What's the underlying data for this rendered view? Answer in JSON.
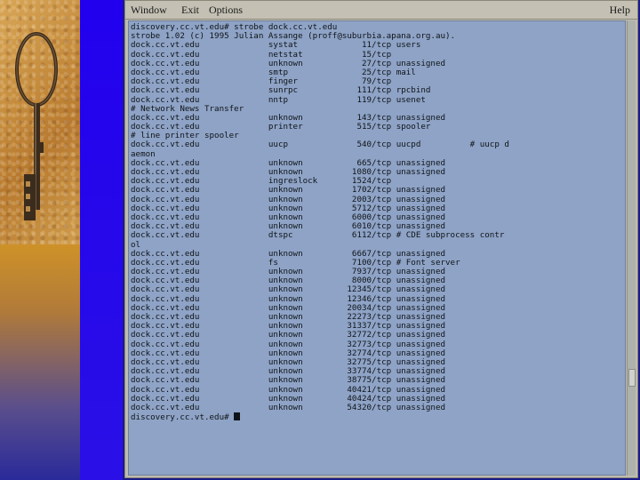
{
  "menubar": {
    "window_label": "Window",
    "exit_label": "Exit",
    "options_label": "Options",
    "help_label": "Help"
  },
  "terminal": {
    "lines": [
      "discovery.cc.vt.edu# strobe dock.cc.vt.edu",
      "strobe 1.02 (c) 1995 Julian Assange (proff@suburbia.apana.org.au).",
      "dock.cc.vt.edu              systat             11/tcp users",
      "dock.cc.vt.edu              netstat            15/tcp",
      "dock.cc.vt.edu              unknown            27/tcp unassigned",
      "dock.cc.vt.edu              smtp               25/tcp mail",
      "dock.cc.vt.edu              finger             79/tcp",
      "dock.cc.vt.edu              sunrpc            111/tcp rpcbind",
      "dock.cc.vt.edu              nntp              119/tcp usenet",
      "# Network News Transfer",
      "dock.cc.vt.edu              unknown           143/tcp unassigned",
      "dock.cc.vt.edu              printer           515/tcp spooler",
      "# line printer spooler",
      "dock.cc.vt.edu              uucp              540/tcp uucpd          # uucp d",
      "aemon",
      "dock.cc.vt.edu              unknown           665/tcp unassigned",
      "dock.cc.vt.edu              unknown          1080/tcp unassigned",
      "dock.cc.vt.edu              ingreslock       1524/tcp",
      "dock.cc.vt.edu              unknown          1702/tcp unassigned",
      "dock.cc.vt.edu              unknown          2003/tcp unassigned",
      "dock.cc.vt.edu              unknown          5712/tcp unassigned",
      "dock.cc.vt.edu              unknown          6000/tcp unassigned",
      "dock.cc.vt.edu              unknown          6010/tcp unassigned",
      "dock.cc.vt.edu              dtspc            6112/tcp # CDE subprocess contr",
      "ol",
      "dock.cc.vt.edu              unknown          6667/tcp unassigned",
      "dock.cc.vt.edu              fs               7100/tcp # Font server",
      "dock.cc.vt.edu              unknown          7937/tcp unassigned",
      "dock.cc.vt.edu              unknown          8000/tcp unassigned",
      "dock.cc.vt.edu              unknown         12345/tcp unassigned",
      "dock.cc.vt.edu              unknown         12346/tcp unassigned",
      "dock.cc.vt.edu              unknown         20034/tcp unassigned",
      "dock.cc.vt.edu              unknown         22273/tcp unassigned",
      "dock.cc.vt.edu              unknown         31337/tcp unassigned",
      "dock.cc.vt.edu              unknown         32772/tcp unassigned",
      "dock.cc.vt.edu              unknown         32773/tcp unassigned",
      "dock.cc.vt.edu              unknown         32774/tcp unassigned",
      "dock.cc.vt.edu              unknown         32775/tcp unassigned",
      "dock.cc.vt.edu              unknown         33774/tcp unassigned",
      "dock.cc.vt.edu              unknown         38775/tcp unassigned",
      "dock.cc.vt.edu              unknown         40421/tcp unassigned",
      "dock.cc.vt.edu              unknown         40424/tcp unassigned",
      "dock.cc.vt.edu              unknown         54320/tcp unassigned"
    ],
    "prompt": "discovery.cc.vt.edu# "
  },
  "colors": {
    "terminal_bg": "#8ea3c6",
    "window_frame": "#bfbcb0",
    "slide_blue": "#2200ee",
    "slide_gold": "#f2b21a"
  }
}
